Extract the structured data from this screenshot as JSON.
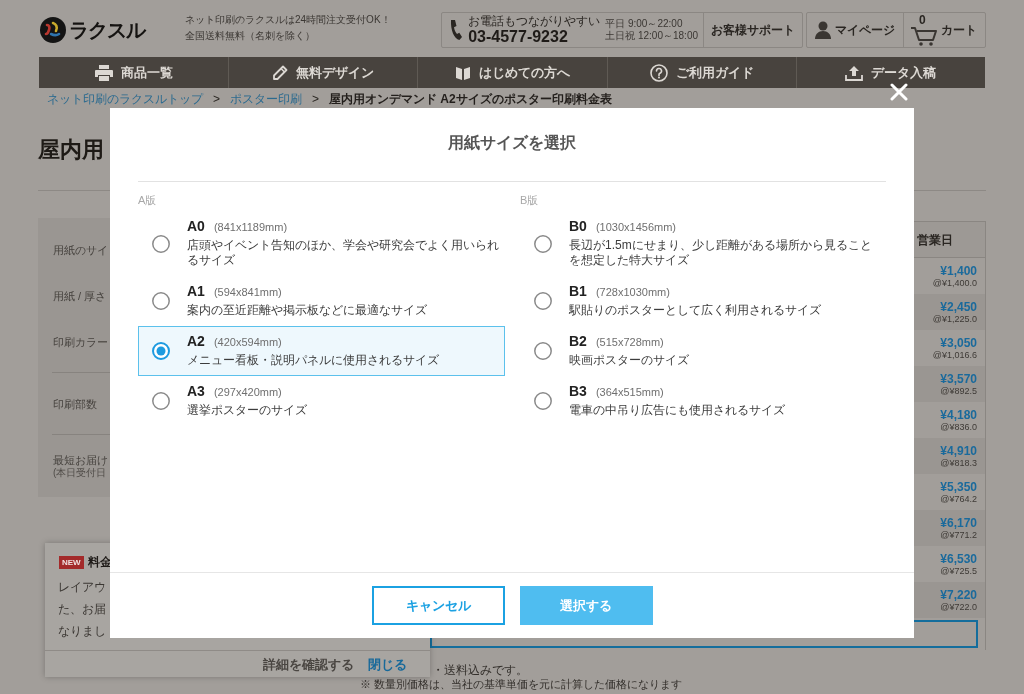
{
  "header": {
    "logo": "ラクスル",
    "tagline": [
      "ネット印刷のラクスルは24時間注文受付OK！",
      "全国送料無料（名刺を除く）"
    ],
    "phone": {
      "label": "お電話もつながりやすい",
      "number": "03-4577-9232",
      "hours": [
        "平日 9:00～22:00",
        "土日祝 12:00～18:00"
      ],
      "support": "お客様サポート"
    },
    "account": {
      "mypage": "マイページ",
      "cart_count": "0",
      "cart": "カート"
    }
  },
  "nav": [
    {
      "label": "商品一覧"
    },
    {
      "label": "無料デザイン"
    },
    {
      "label": "はじめての方へ"
    },
    {
      "label": "ご利用ガイド"
    },
    {
      "label": "データ入稿"
    }
  ],
  "breadcrumb": [
    {
      "kind": "link",
      "label": "ネット印刷のラクスルトップ"
    },
    {
      "kind": "separator",
      "label": ">"
    },
    {
      "kind": "link",
      "label": "ポスター印刷"
    },
    {
      "kind": "separator",
      "label": ">"
    },
    {
      "kind": "current",
      "label": "屋内用オンデマンド A2サイズのポスター印刷料金表"
    }
  ],
  "page": {
    "heading": "屋内用",
    "spec_groups": [
      {
        "items": [
          {
            "label": "用紙のサイ"
          },
          {
            "label": "用紙 / 厚さ"
          },
          {
            "label": "印刷カラー"
          }
        ]
      },
      {
        "items": [
          {
            "label": "印刷部数"
          }
        ]
      },
      {
        "items": [
          {
            "label": "最短お届け",
            "note": "(本日受付日"
          }
        ]
      }
    ],
    "price_table": {
      "header": "営業日",
      "rows": [
        {
          "price": "¥1,400",
          "unit": "@¥1,400.0"
        },
        {
          "price": "¥2,450",
          "unit": "@¥1,225.0"
        },
        {
          "price": "¥3,050",
          "unit": "@¥1,016.6"
        },
        {
          "price": "¥3,570",
          "unit": "@¥892.5"
        },
        {
          "price": "¥4,180",
          "unit": "@¥836.0"
        },
        {
          "price": "¥4,910",
          "unit": "@¥818.3"
        },
        {
          "price": "¥5,350",
          "unit": "@¥764.2"
        },
        {
          "price": "¥6,170",
          "unit": "@¥771.2"
        },
        {
          "price": "¥6,530",
          "unit": "@¥725.5"
        },
        {
          "price": "¥7,220",
          "unit": "@¥722.0"
        }
      ]
    },
    "notes": [
      "・送料込みです。",
      "※ 数量別価格は、当社の基準単価を元に計算した価格になります"
    ]
  },
  "notification": {
    "badge": "NEW",
    "title": "料金",
    "lines": [
      "レイアウ",
      "た、お届",
      "なりまし"
    ],
    "links": [
      {
        "kind": "details",
        "label": "詳細を確認する"
      },
      {
        "kind": "close",
        "label": "閉じる"
      }
    ]
  },
  "dialog": {
    "title": "用紙サイズを選択",
    "groups": [
      {
        "label": "A版",
        "options": [
          {
            "name": "A0",
            "size": "(841x1189mm)",
            "description": "店頭やイベント告知のほか、学会や研究会でよく用いられるサイズ",
            "selected": false
          },
          {
            "name": "A1",
            "size": "(594x841mm)",
            "description": "案内の至近距離や掲示板などに最適なサイズ",
            "selected": false
          },
          {
            "name": "A2",
            "size": "(420x594mm)",
            "description": "メニュー看板・説明パネルに使用されるサイズ",
            "selected": true
          },
          {
            "name": "A3",
            "size": "(297x420mm)",
            "description": "選挙ポスターのサイズ",
            "selected": false
          }
        ]
      },
      {
        "label": "B版",
        "options": [
          {
            "name": "B0",
            "size": "(1030x1456mm)",
            "description": "長辺が1.5mにせまり、少し距離がある場所から見ることを想定した特大サイズ",
            "selected": false
          },
          {
            "name": "B1",
            "size": "(728x1030mm)",
            "description": "駅貼りのポスターとして広く利用されるサイズ",
            "selected": false
          },
          {
            "name": "B2",
            "size": "(515x728mm)",
            "description": "映画ポスターのサイズ",
            "selected": false
          },
          {
            "name": "B3",
            "size": "(364x515mm)",
            "description": "電車の中吊り広告にも使用されるサイズ",
            "selected": false
          }
        ]
      }
    ],
    "buttons": [
      {
        "kind": "secondary",
        "label": "キャンセル"
      },
      {
        "kind": "primary",
        "label": "選択する"
      }
    ]
  }
}
